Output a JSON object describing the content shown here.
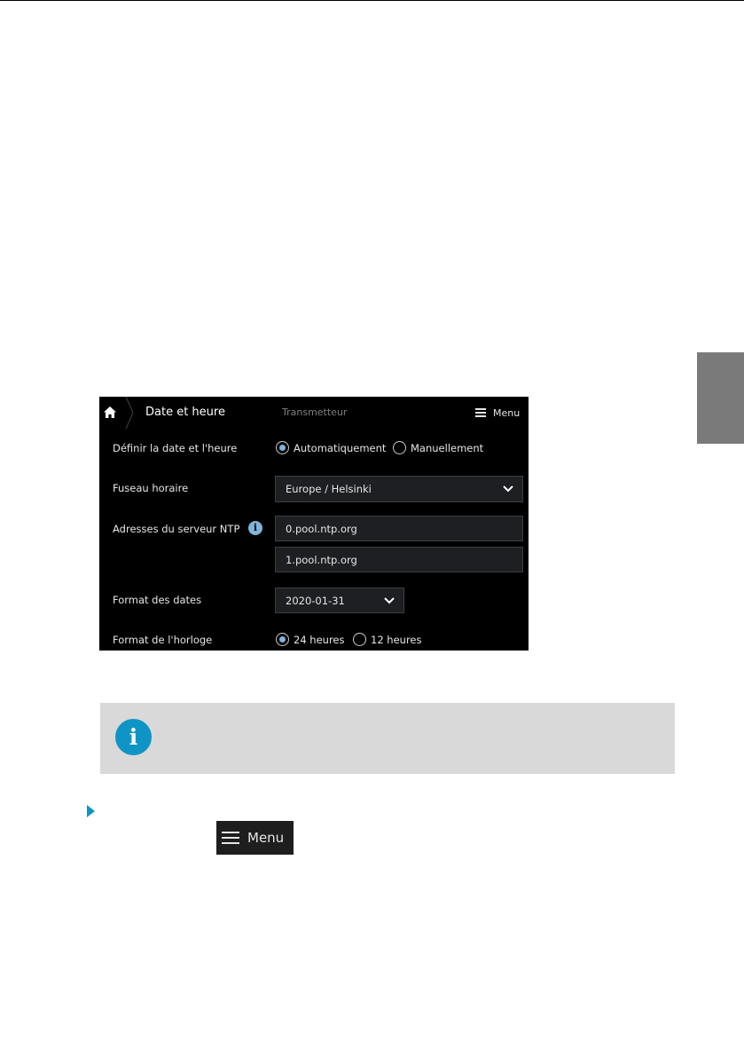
{
  "screen": {
    "title": "Date et heure",
    "breadcrumb": "Transmetteur",
    "menu_label": "Menu",
    "rows": {
      "datetime": {
        "label": "Définir la date et l'heure",
        "options": [
          "Automatiquement",
          "Manuellement"
        ],
        "selected": "Automatiquement"
      },
      "timezone": {
        "label": "Fuseau horaire",
        "value": "Europe / Helsinki"
      },
      "ntp": {
        "label": "Adresses du serveur NTP",
        "servers": [
          "0.pool.ntp.org",
          "1.pool.ntp.org"
        ]
      },
      "date_format": {
        "label": "Format des dates",
        "value": "2020-01-31"
      },
      "clock_format": {
        "label": "Format de l'horloge",
        "options": [
          "24 heures",
          "12 heures"
        ],
        "selected": "24 heures"
      }
    }
  },
  "note": {
    "icon": "info-icon"
  },
  "step": {
    "menu_button_label": "Menu"
  },
  "colors": {
    "accent": "#0e95c6",
    "radio_on": "#7fb4d9",
    "note_bg": "#d9d9d9",
    "side_tab": "#7a7a7a"
  }
}
